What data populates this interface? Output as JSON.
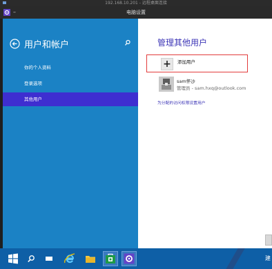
{
  "remote_desktop": {
    "title": "192.168.10.201 - 远程桌面连接"
  },
  "app": {
    "title": "电脑设置",
    "minimize_label": "–"
  },
  "left_pane": {
    "title": "用户和帐户",
    "nav_items": [
      {
        "label": "你的个人资料"
      },
      {
        "label": "登录选项"
      },
      {
        "label": "其他用户"
      }
    ],
    "active_index": 2
  },
  "right_pane": {
    "section_title": "管理其他用户",
    "add_user_label": "添加用户",
    "account": {
      "name": "sam怀沙",
      "subtitle": "管理员 - sam.hxq@outlook.com"
    },
    "assign_access_link": "为分配的访问权限设置用户"
  },
  "taskbar": {
    "tray_text": "建"
  },
  "colors": {
    "left_pane_bg": "#1b82c5",
    "active_nav_bg": "#3e2ed0",
    "accent_text": "#3c35b6",
    "highlight_border": "#e23a3a",
    "taskbar_bg": "#0e5fa6"
  }
}
